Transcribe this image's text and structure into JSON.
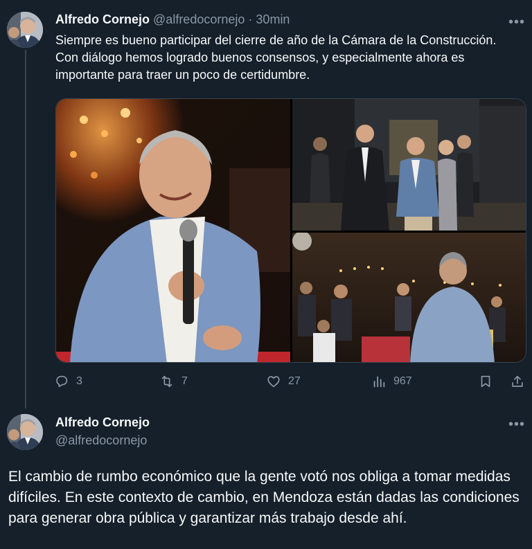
{
  "tweet1": {
    "author_name": "Alfredo Cornejo",
    "author_handle": "@alfredocornejo",
    "separator": "·",
    "time": "30min",
    "text": "Siempre es bueno participar del cierre de año de la Cámara de la Construcción. Con diálogo hemos logrado buenos consensos, y especialmente ahora es importante para traer un poco de certidumbre.",
    "media": [
      {
        "icon": "photo-speaker-microphone"
      },
      {
        "icon": "photo-group-arrival"
      },
      {
        "icon": "photo-crowd-event"
      }
    ],
    "actions": {
      "replies": "3",
      "reposts": "7",
      "likes": "27",
      "views": "967"
    }
  },
  "tweet2": {
    "author_name": "Alfredo Cornejo",
    "author_handle": "@alfredocornejo",
    "text": "El cambio de rumbo económico que la gente votó nos obliga a tomar medidas difíciles. En este contexto de cambio, en Mendoza están dadas las condiciones para generar obra pública y garantizar más trabajo desde ahí."
  },
  "icons": {
    "more": "ellipsis-icon",
    "reply": "reply-icon",
    "repost": "repost-icon",
    "like": "heart-icon",
    "views": "views-icon",
    "bookmark": "bookmark-icon",
    "share": "share-icon"
  },
  "colors": {
    "background": "#15202b",
    "text": "#f7f9f9",
    "secondary": "#8b98a5",
    "divider": "#38444d"
  }
}
